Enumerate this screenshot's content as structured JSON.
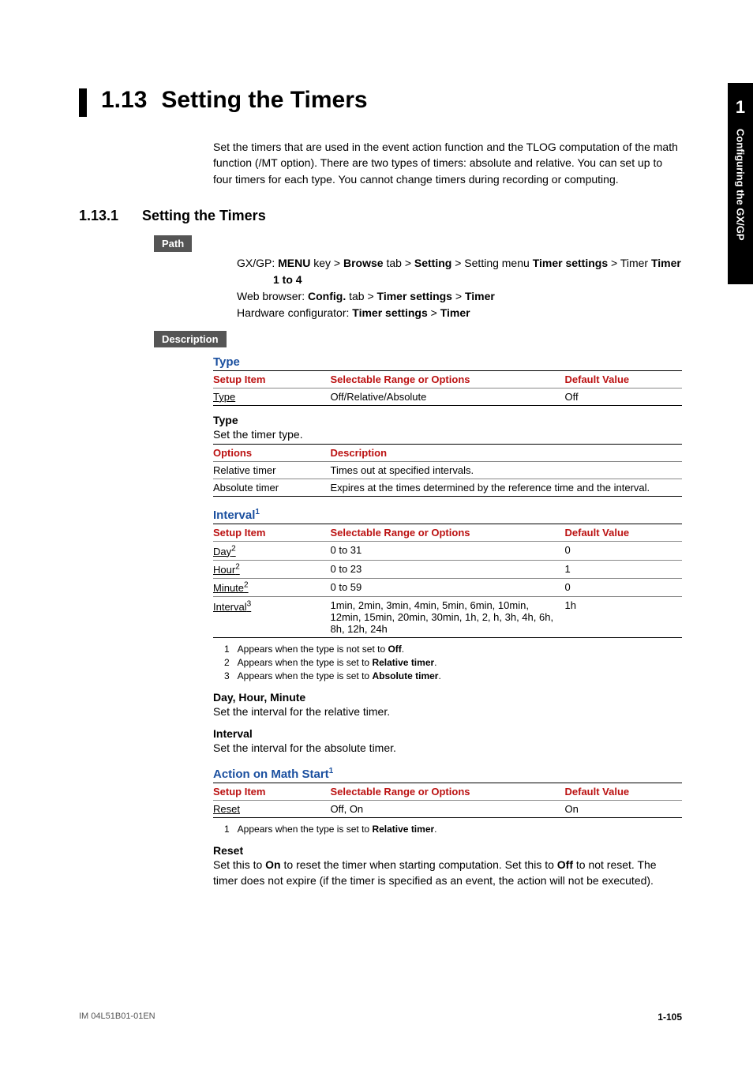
{
  "side": {
    "num": "1",
    "text": "Configuring the GX/GP"
  },
  "h1": {
    "num": "1.13",
    "title": "Setting the Timers"
  },
  "intro": "Set the timers that are used in the event action function and the TLOG computation of the math function (/MT option). There are two types of timers: absolute and relative. You can set up to four timers for each type. You cannot change timers during recording or computing.",
  "h2": {
    "num": "1.13.1",
    "title": "Setting the Timers"
  },
  "pill_path": "Path",
  "path": {
    "l1a": "GX/GP: ",
    "l1b": "MENU",
    "l1c": " key > ",
    "l1d": "Browse",
    "l1e": " tab > ",
    "l1f": "Setting",
    "l1g": " > Setting menu ",
    "l1h": "Timer settings",
    "l1i": " > Timer ",
    "l1j": "Timer",
    "l1k": "1 to 4",
    "l2a": "Web browser: ",
    "l2b": "Config.",
    "l2c": " tab > ",
    "l2d": "Timer settings",
    "l2e": " > ",
    "l2f": "Timer",
    "l3a": "Hardware configurator: ",
    "l3b": "Timer settings",
    "l3c": " > ",
    "l3d": "Timer"
  },
  "pill_desc": "Description",
  "type_section": {
    "title": "Type",
    "headers": {
      "c1": "Setup Item",
      "c2": "Selectable Range or Options",
      "c3": "Default Value"
    },
    "row": {
      "c1": "Type",
      "c2": "Off/Relative/Absolute",
      "c3": "Off"
    },
    "sub_title": "Type",
    "sub_text": "Set the timer type.",
    "opt_headers": {
      "c1": "Options",
      "c2": "Description"
    },
    "opt_rows": [
      {
        "c1": "Relative timer",
        "c2": "Times out at specified intervals."
      },
      {
        "c1": "Absolute timer",
        "c2": "Expires at the times determined by the reference time and the interval."
      }
    ]
  },
  "interval_section": {
    "title": "Interval",
    "sup": "1",
    "headers": {
      "c1": "Setup Item",
      "c2": "Selectable Range or Options",
      "c3": "Default Value"
    },
    "rows": [
      {
        "c1": "Day",
        "s": "2",
        "c2": "0 to 31",
        "c3": "0"
      },
      {
        "c1": "Hour",
        "s": "2",
        "c2": "0 to 23",
        "c3": "1"
      },
      {
        "c1": "Minute",
        "s": "2",
        "c2": "0 to 59",
        "c3": "0"
      },
      {
        "c1": "Interval",
        "s": "3",
        "c2": "1min, 2min, 3min, 4min, 5min, 6min, 10min, 12min, 15min, 20min, 30min, 1h, 2, h, 3h, 4h, 6h, 8h, 12h, 24h",
        "c3": "1h"
      }
    ],
    "notes": [
      "1   Appears when the type is not set to Off.",
      "2   Appears when the type is set to Relative timer.",
      "3   Appears when the type is set to Absolute timer."
    ],
    "dhm_title": "Day, Hour, Minute",
    "dhm_text": "Set the interval for the relative timer.",
    "int_title": "Interval",
    "int_text": "Set the interval for the absolute timer."
  },
  "action_section": {
    "title": "Action on Math Start",
    "sup": "1",
    "headers": {
      "c1": "Setup Item",
      "c2": "Selectable Range or Options",
      "c3": "Default Value"
    },
    "row": {
      "c1": "Reset",
      "c2": "Off, On",
      "c3": "On"
    },
    "note": "1   Appears when the type is set to Relative timer.",
    "reset_title": "Reset",
    "reset_a": "Set this to ",
    "reset_b": "On",
    "reset_c": " to reset the timer when starting computation. Set this to ",
    "reset_d": "Off",
    "reset_e": " to not reset. The timer does not expire (if the timer is specified as an event, the action will not be executed)."
  },
  "footer": {
    "left": "IM 04L51B01-01EN",
    "right": "1-105"
  },
  "notes_bold": {
    "off": "Off",
    "rel": "Relative timer",
    "abs": "Absolute timer"
  },
  "chart_data": {
    "type": "table",
    "tables": [
      {
        "name": "Type",
        "columns": [
          "Setup Item",
          "Selectable Range or Options",
          "Default Value"
        ],
        "rows": [
          [
            "Type",
            "Off/Relative/Absolute",
            "Off"
          ]
        ]
      },
      {
        "name": "Type options",
        "columns": [
          "Options",
          "Description"
        ],
        "rows": [
          [
            "Relative timer",
            "Times out at specified intervals."
          ],
          [
            "Absolute timer",
            "Expires at the times determined by the reference time and the interval."
          ]
        ]
      },
      {
        "name": "Interval",
        "columns": [
          "Setup Item",
          "Selectable Range or Options",
          "Default Value"
        ],
        "rows": [
          [
            "Day",
            "0 to 31",
            "0"
          ],
          [
            "Hour",
            "0 to 23",
            "1"
          ],
          [
            "Minute",
            "0 to 59",
            "0"
          ],
          [
            "Interval",
            "1min, 2min, 3min, 4min, 5min, 6min, 10min, 12min, 15min, 20min, 30min, 1h, 2, h, 3h, 4h, 6h, 8h, 12h, 24h",
            "1h"
          ]
        ]
      },
      {
        "name": "Action on Math Start",
        "columns": [
          "Setup Item",
          "Selectable Range or Options",
          "Default Value"
        ],
        "rows": [
          [
            "Reset",
            "Off, On",
            "On"
          ]
        ]
      }
    ]
  }
}
